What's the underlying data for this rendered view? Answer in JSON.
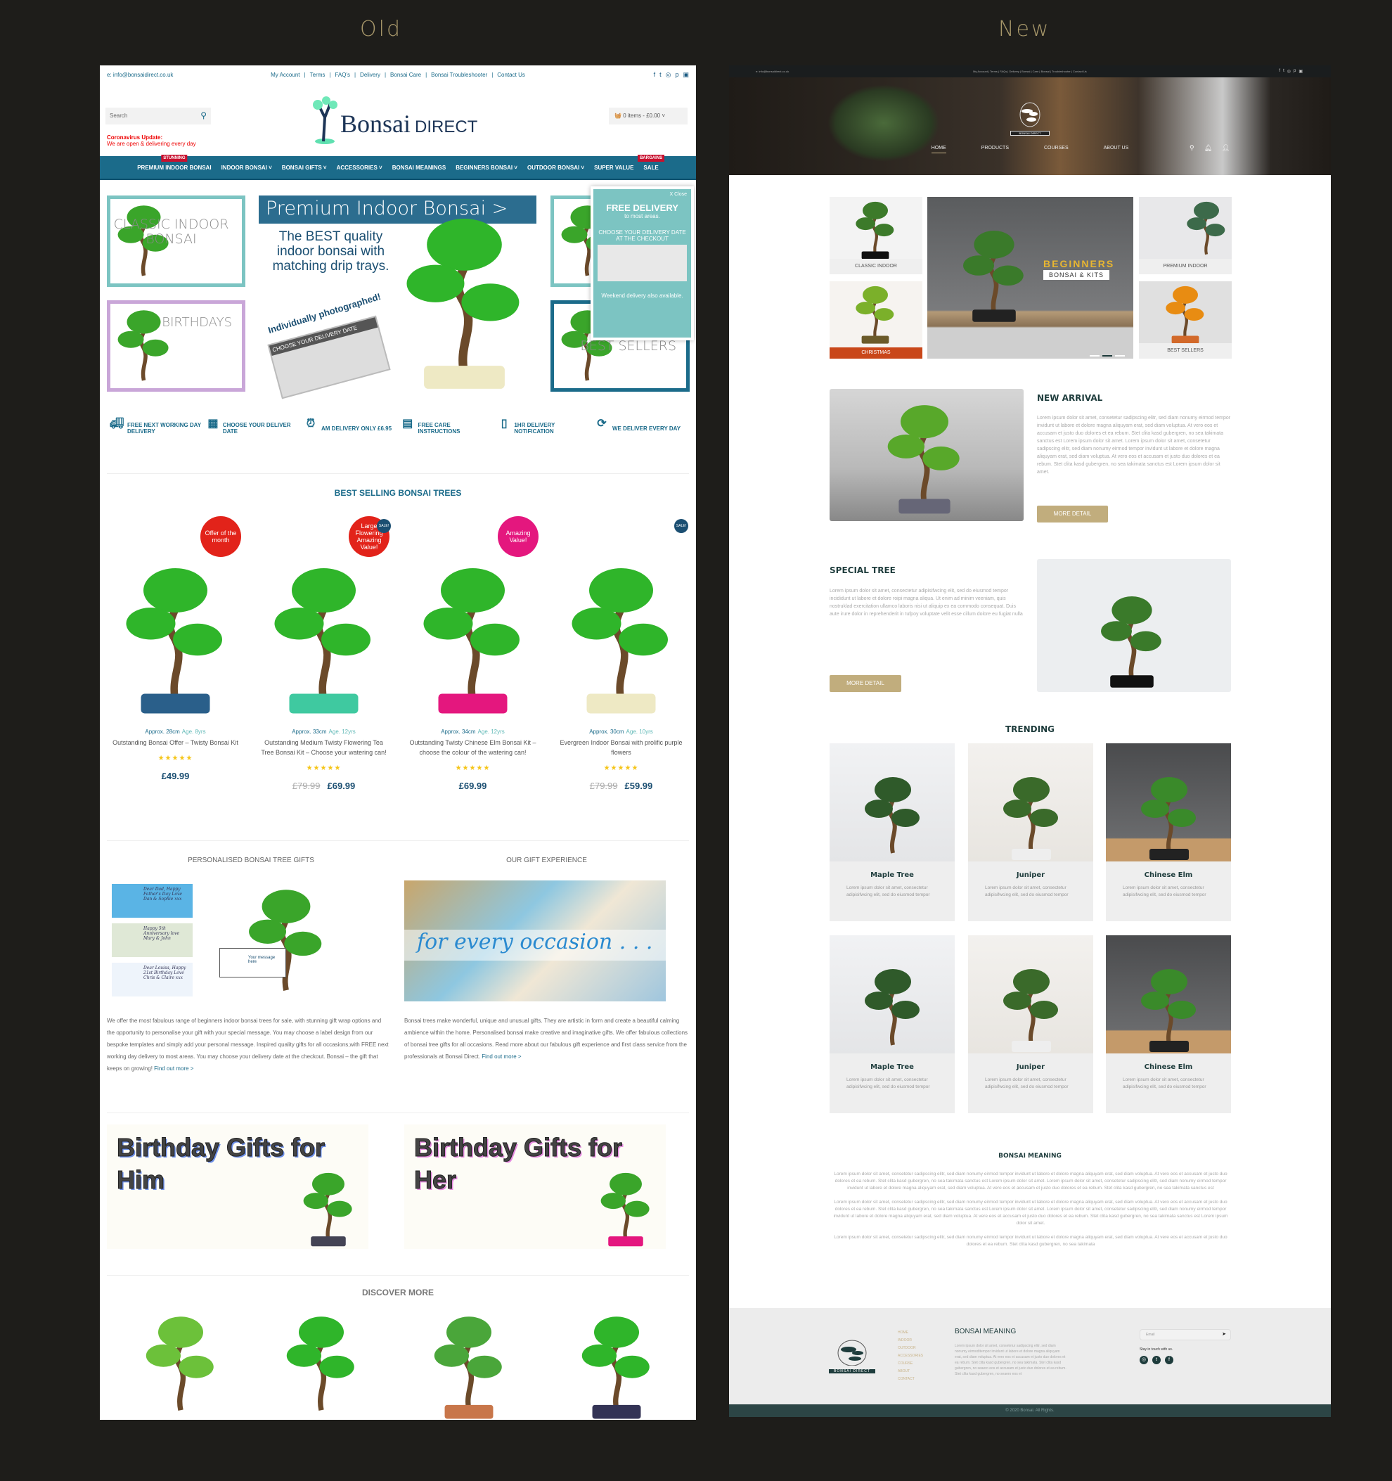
{
  "labels": {
    "old": "Old",
    "new": "New"
  },
  "old": {
    "top_bar": {
      "email": "e: info@bonsaidirect.co.uk",
      "links": [
        "My Account",
        "Terms",
        "FAQ's",
        "Delivery",
        "Bonsai Care",
        "Bonsai Troubleshooter",
        "Contact Us"
      ],
      "social": [
        "facebook-icon",
        "twitter-icon",
        "instagram-icon",
        "pinterest-icon",
        "youtube-icon"
      ]
    },
    "header": {
      "search_placeholder": "Search",
      "corona_title": "Coronavirus Update:",
      "corona_text": "We are open & delivering every day",
      "logo_main": "Bonsai",
      "logo_sub": "DIRECT",
      "cart": "0 items - £0.00"
    },
    "nav": [
      {
        "label": "PREMIUM INDOOR BONSAI",
        "badge": "STUNNING"
      },
      {
        "label": "INDOOR BONSAI ˅"
      },
      {
        "label": "BONSAI GIFTS ˅"
      },
      {
        "label": "ACCESSORIES ˅"
      },
      {
        "label": "BONSAI MEANINGS"
      },
      {
        "label": "BEGINNERS BONSAI ˅"
      },
      {
        "label": "OUTDOOR BONSAI ˅"
      },
      {
        "label": "SUPER VALUE"
      },
      {
        "label": "SALE",
        "badge": "BARGAINS"
      }
    ],
    "hero": {
      "classic": "CLASSIC INDOOR BONSAI",
      "birthdays": "BIRTHDAYS",
      "banner_title": "Premium Indoor Bonsai >",
      "banner_text": "The BEST quality indoor bonsai with matching drip trays.",
      "photographed": "Individually photographed!",
      "calendar": "CHOOSE YOUR DELIVERY DATE",
      "best_sellers": "BEST SELLERS",
      "popup": {
        "close": "X Close",
        "title": "FREE DELIVERY",
        "sub": "to most areas.",
        "choose": "CHOOSE YOUR DELIVERY DATE AT THE CHECKOUT",
        "weekend": "Weekend delivery also available."
      }
    },
    "features": [
      {
        "icon": "truck-icon",
        "text": "FREE NEXT WORKING DAY DELIVERY"
      },
      {
        "icon": "calendar-icon",
        "text": "CHOOSE YOUR DELIVER DATE"
      },
      {
        "icon": "alarm-clock-icon",
        "text": "AM DELIVERY ONLY £6.95"
      },
      {
        "icon": "care-book-icon",
        "text": "FREE CARE INSTRUCTIONS"
      },
      {
        "icon": "phone-icon",
        "text": "1HR DELIVERY NOTIFICATION"
      },
      {
        "icon": "seven-days-icon",
        "text": "WE DELIVER EVERY DAY"
      }
    ],
    "best_selling": {
      "title": "BEST SELLING BONSAI TREES",
      "products": [
        {
          "size": "Approx. 28cm",
          "age": "Age. 8yrs",
          "title": "Outstanding Bonsai Offer – Twisty Bonsai Kit",
          "rating": 5,
          "old_price": "",
          "price": "£49.99",
          "sticker": "Offer of the month",
          "sticker_color": "#e2231a"
        },
        {
          "size": "Approx. 33cm",
          "age": "Age. 12yrs",
          "title": "Outstanding Medium Twisty Flowering Tea Tree Bonsai Kit – Choose your watering can!",
          "rating": 5,
          "old_price": "£79.99",
          "price": "£69.99",
          "sticker": "Large Flowering Amazing Value!",
          "sticker_color": "#e2231a",
          "sale": "SALE!"
        },
        {
          "size": "Approx. 34cm",
          "age": "Age. 12yrs",
          "title": "Outstanding Twisty Chinese Elm Bonsai Kit – choose the colour of the watering can!",
          "rating": 5,
          "old_price": "",
          "price": "£69.99",
          "sticker": "Amazing Value!",
          "sticker_color": "#e4177e"
        },
        {
          "size": "Approx. 30cm",
          "age": "Age. 10yrs",
          "title": "Evergreen Indoor Bonsai with prolific purple flowers",
          "rating": 5,
          "old_price": "£79.99",
          "price": "£59.99",
          "sticker": "",
          "sale": "SALE!"
        }
      ]
    },
    "gifts": {
      "left_title": "PERSONALISED BONSAI TREE GIFTS",
      "labels": [
        "Dear Dad, Happy Father's Day Love Dan & Sophie xxx",
        "Happy 5th Anniversary love Mary & John",
        "Dear Louisa, Happy 21st Birthday Love Chris & Claire xxx"
      ],
      "tag": "Your message here",
      "left_text": "We offer the most fabulous range of beginners indoor bonsai trees for sale, with stunning gift wrap options and the opportunity to personalise your gift with your special message.  You may choose a label design from our bespoke templates and simply add your personal message. Inspired quality gifts for all occasions,with FREE next working day delivery to most areas. You may choose your delivery date at the checkout. Bonsai – the gift that keeps on growing!",
      "left_link": "Find out more >",
      "right_title": "OUR GIFT EXPERIENCE",
      "occasion": "for every occasion . . .",
      "right_text": "Bonsai trees make wonderful, unique and unusual gifts. They are artistic in form and create a beautiful calming ambience within the home. Personalised bonsai make creative and imaginative gifts. We offer fabulous collections of bonsai tree gifts for all occasions. Read more about our fabulous gift experience and first class service from the professionals at Bonsai Direct.",
      "right_link": "Find out more >"
    },
    "banners": [
      {
        "title": "Birthday Gifts for Him",
        "accent": "#6c8ee8"
      },
      {
        "title": "Birthday Gifts for Her",
        "accent": "#e58ae0"
      }
    ],
    "discover": {
      "title": "DISCOVER MORE"
    },
    "colors": {
      "brand": "#1b6b8a",
      "teal": "#7cc4c2",
      "badge": "#c8102e"
    }
  },
  "new": {
    "top_bar": {
      "email": "e: info@bonsaidirect.co.uk",
      "links": "My Account | Terms | FAQs | Delivery | Bonsai | Care | Bonsai | Troubleshooter | Contact Us",
      "social": [
        "facebook-icon",
        "twitter-icon",
        "instagram-icon",
        "pinterest-icon",
        "youtube-icon"
      ]
    },
    "logo": "BONSAI DIRECT",
    "nav": [
      "HOME",
      "PRODUCTS",
      "COURSES",
      "ABOUT US"
    ],
    "nav_active": "HOME",
    "grid": {
      "classic": "CLASSIC INDOOR",
      "christmas": "CHRISTMAS",
      "beginners": "BEGINNERS",
      "kits": "BONSAI & KITS",
      "premium": "PREMIUM INDOOR",
      "best": "BEST SELLERS",
      "slide": 2,
      "slides": 3
    },
    "new_arrival": {
      "title": "NEW ARRIVAL",
      "text": "Lorem ipsum dolor sit amet, consetetur sadipscing elitr, sed diam nonumy eirmod tempor invidunt ut labore et dolore magna aliquyam erat, sed diam voluptua. At vero eos et accusam et justo duo dolores et ea rebum. Stet clita kasd gubergren, no sea takimata sanctus est Lorem ipsum dolor sit amet. Lorem ipsum dolor sit amet, consetetur sadipscing elitr, sed diam nonumy eirmod tempor invidunt ut labore et dolore magna aliquyam erat, sed diam voluptua. At vero eos et accusam et justo duo dolores et ea rebum. Stet clita kasd gubergren, no sea takimata sanctus est Lorem ipsum dolor sit amet.",
      "button": "MORE DETAIL"
    },
    "special_tree": {
      "title": "SPECIAL TREE",
      "text": "Lorem ipsum dolor sit amet, consectetur adipisifwcing elit, sed do eiusmod tempor incididunt ut labore et dolore roipi magna aliqua. Ut enim ad minim veeniam, quis nostruklad exercitation ullamco laboris nisi ut aliquip ex ea commodo consequat. Duis aute irure dolor in reprehenderit in tufpoy voluptate velit esse cillum dolore eu fugiat nulla",
      "button": "MORE DETAIL"
    },
    "trending": {
      "title": "TRENDING",
      "items": [
        {
          "name": "Maple Tree",
          "text": "Lorem ipsum dolor sit amet, consectetur adipisifwcing elit, sed do eiusmod tempor"
        },
        {
          "name": "Juniper",
          "text": "Lorem ipsum dolor sit amet, consectetur adipisifwcing elit, sed do eiusmod tempor"
        },
        {
          "name": "Chinese Elm",
          "text": "Lorem ipsum dolor sit amet, consectetur adipisifwcing elit, sed do eiusmod tempor"
        },
        {
          "name": "Maple Tree",
          "text": "Lorem ipsum dolor sit amet, consectetur adipisifwcing elit, sed do eiusmod tempor"
        },
        {
          "name": "Juniper",
          "text": "Lorem ipsum dolor sit amet, consectetur adipisifwcing elit, sed do eiusmod tempor"
        },
        {
          "name": "Chinese Elm",
          "text": "Lorem ipsum dolor sit amet, consectetur adipisifwcing elit, sed do eiusmod tempor"
        }
      ]
    },
    "meaning": {
      "title": "BONSAI MEANING",
      "paragraphs": [
        "Lorem ipsum dolor sit amet, consetetur sadipscing elitr, sed diam nonumy eirmod tempor invidunt ut labore et dolore magna aliquyam erat, sed diam voluptua. At vero eos et accusam et justo duo dolores et ea rebum. Stet clita kasd gubergren, no sea takimata sanctus est Lorem ipsum dolor sit amet. Lorem ipsum dolor sit amet, consetetur sadipscing elitr, sed diam nonumy eirmod tempor invidunt ut labore et dolore magna aliquyam erat, sed diam voluptua. At vero eos et accusam et justo duo dolores et ea rebum. Stet clita kasd gubergren, no sea takimata sanctus est",
        "Lorem ipsum dolor sit amet, consetetur sadipscing elitr, sed diam nonumy eirmod tempor invidunt ut labore et dolore magna aliquyam erat, sed diam voluptua. At vero eos et accusam et justo duo dolores et ea rebum. Stet clita kasd gubergren, no sea takimata sanctus est Lorem ipsum dolor sit amet. Lorem ipsum dolor sit amet, consetetur sadipscing elitr, sed diam nonumy eirmod tempor invidunt ut labore et dolore magna aliquyam erat, sed diam voluptua. At vere eos et accusam et justo duo dolores et ea rebum. Stet clita kasd gubergren, no sea takimata sanctus est Lorem ipsum dolor sit amet.",
        "Lorem ipsum dolor sit amet, consetetur sadipscing elitr, sed diam nonumy eirmod tempor invidunt ut labore et dolore magna aliquyam erat, sed diam voluptua. At vere eos et accusam et justo duo dolores et ea rebum. Stet clita kasd gubergren, no sea takimata"
      ]
    },
    "footer": {
      "links": [
        "HOME",
        "INDOOR",
        "OUTDOOR",
        "ACCESSORIES",
        "COURSE",
        "ABOUT",
        "CONTACT"
      ],
      "title": "BONSAI MEANING",
      "text": "Lorem ipsum dolor sit amet, consetetur sadipscing elitr, sed diam nonumy eirmoditempor invidunt ut labore et dolore magna aliquyam erat, sed diam voluptua. At vero eos et accusam et justo duo dolores et ea rebum. Stet clita kasd gubergren, no sea takimata. Stet clita kasd gubergren, no seaero eos et accusam et justo duo dolores et ea rebum. Stet clita kasd gubergren, no seaero eos et",
      "email_placeholder": "Email",
      "stay": "Stay in touch with us.",
      "social": [
        "instagram-icon",
        "twitter-icon",
        "facebook-icon"
      ],
      "copyright": "© 2020 Bonsai. All Rights."
    },
    "colors": {
      "dark": "#1e3c3c",
      "gold": "#c1ad7d",
      "christmas": "#c9471a",
      "footer_bar": "#2c4545",
      "beginners": "#e8b631"
    }
  }
}
